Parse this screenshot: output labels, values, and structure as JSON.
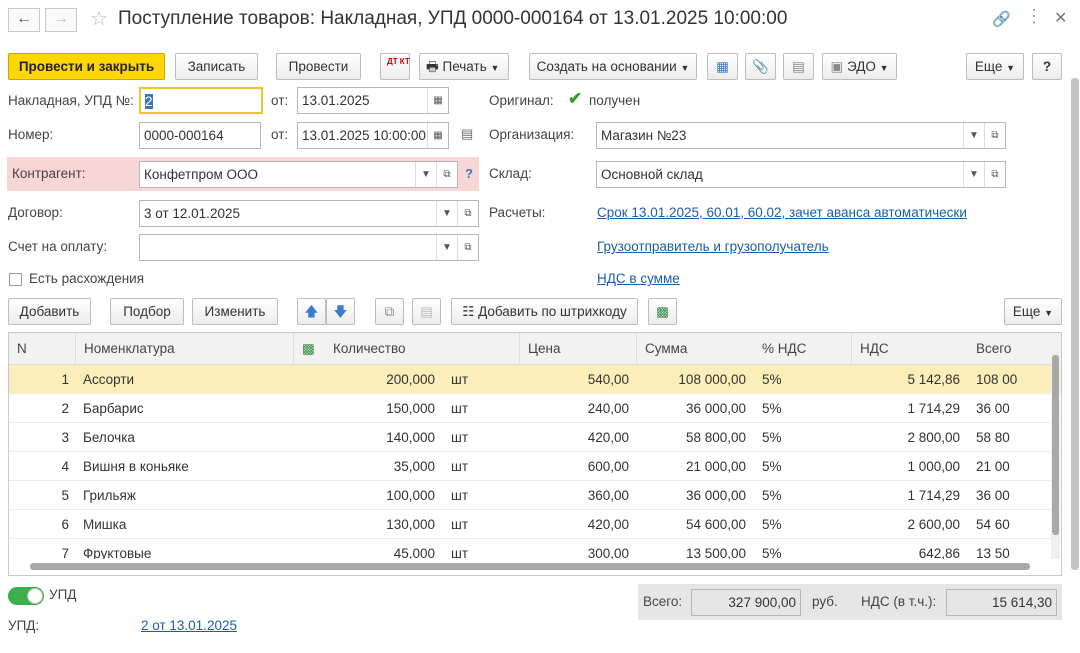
{
  "window": {
    "title": "Поступление товаров: Накладная, УПД 0000-000164 от 13.01.2025 10:00:00"
  },
  "toolbar": {
    "post_close": "Провести и закрыть",
    "save": "Записать",
    "post": "Провести",
    "dtkt": "ДТ КТ",
    "print": "Печать",
    "create_based": "Создать на основании",
    "edo": "ЭДО",
    "more": "Еще",
    "help": "?"
  },
  "form": {
    "invoice_label": "Накладная, УПД №:",
    "invoice_value": "2",
    "from_label": "от:",
    "invoice_date": "13.01.2025",
    "original_label": "Оригинал:",
    "original_checked_label": "получен",
    "number_label": "Номер:",
    "number_value": "0000-000164",
    "number_date": "13.01.2025 10:00:00",
    "org_label": "Организация:",
    "org_value": "Магазин №23",
    "contractor_label": "Контрагент:",
    "contractor_value": "Конфетпром ООО",
    "warehouse_label": "Склад:",
    "warehouse_value": "Основной склад",
    "contract_label": "Договор:",
    "contract_value": "3 от 12.01.2025",
    "settlements_label": "Расчеты:",
    "settlements_link": "Срок 13.01.2025, 60.01, 60.02, зачет аванса автоматически",
    "invoice_pay_label": "Счет на оплату:",
    "invoice_pay_value": "",
    "shipper_link": "Грузоотправитель и грузополучатель",
    "discrepancies_label": "Есть расхождения",
    "vat_link": "НДС в сумме"
  },
  "table_toolbar": {
    "add": "Добавить",
    "pick": "Подбор",
    "edit": "Изменить",
    "add_barcode": "Добавить по штрихкоду",
    "more": "Еще"
  },
  "table": {
    "columns": [
      "N",
      "Номенклатура",
      "Количество",
      "Цена",
      "Сумма",
      "% НДС",
      "НДС",
      "Всего"
    ],
    "rows": [
      {
        "n": "1",
        "name": "Ассорти",
        "qty": "200,000",
        "unit": "шт",
        "price": "540,00",
        "sum": "108 000,00",
        "vat_rate": "5%",
        "vat": "5 142,86",
        "total": "108 00"
      },
      {
        "n": "2",
        "name": "Барбарис",
        "qty": "150,000",
        "unit": "шт",
        "price": "240,00",
        "sum": "36 000,00",
        "vat_rate": "5%",
        "vat": "1 714,29",
        "total": "36 00"
      },
      {
        "n": "3",
        "name": "Белочка",
        "qty": "140,000",
        "unit": "шт",
        "price": "420,00",
        "sum": "58 800,00",
        "vat_rate": "5%",
        "vat": "2 800,00",
        "total": "58 80"
      },
      {
        "n": "4",
        "name": "Вишня в коньяке",
        "qty": "35,000",
        "unit": "шт",
        "price": "600,00",
        "sum": "21 000,00",
        "vat_rate": "5%",
        "vat": "1 000,00",
        "total": "21 00"
      },
      {
        "n": "5",
        "name": "Грильяж",
        "qty": "100,000",
        "unit": "шт",
        "price": "360,00",
        "sum": "36 000,00",
        "vat_rate": "5%",
        "vat": "1 714,29",
        "total": "36 00"
      },
      {
        "n": "6",
        "name": "Мишка",
        "qty": "130,000",
        "unit": "шт",
        "price": "420,00",
        "sum": "54 600,00",
        "vat_rate": "5%",
        "vat": "2 600,00",
        "total": "54 60"
      },
      {
        "n": "7",
        "name": "Фруктовые",
        "qty": "45,000",
        "unit": "шт",
        "price": "300,00",
        "sum": "13 500,00",
        "vat_rate": "5%",
        "vat": "642,86",
        "total": "13 50"
      }
    ]
  },
  "footer": {
    "upd_toggle_label": "УПД",
    "upd_label": "УПД:",
    "upd_link": "2 от 13.01.2025",
    "total_label": "Всего:",
    "total_value": "327 900,00",
    "currency": "руб.",
    "vat_label": "НДС (в т.ч.):",
    "vat_value": "15 614,30"
  },
  "colors": {
    "primary_button": "#ffd700",
    "selected_row": "#fbeeb8",
    "contractor_highlight": "#f9d6d6",
    "link": "#1a5ea8",
    "toggle_on": "#3cae4a"
  },
  "icons": [
    "back-icon",
    "forward-icon",
    "star-icon",
    "link-icon",
    "more-icon",
    "close-icon",
    "printer-icon",
    "structure-icon",
    "paperclip-icon",
    "document-icon",
    "edo-icon",
    "arrow-up-icon",
    "arrow-down-icon",
    "copy-icon",
    "paste-icon",
    "barcode-icon",
    "spreadsheet-icon",
    "calendar-icon",
    "checkmark-icon"
  ]
}
